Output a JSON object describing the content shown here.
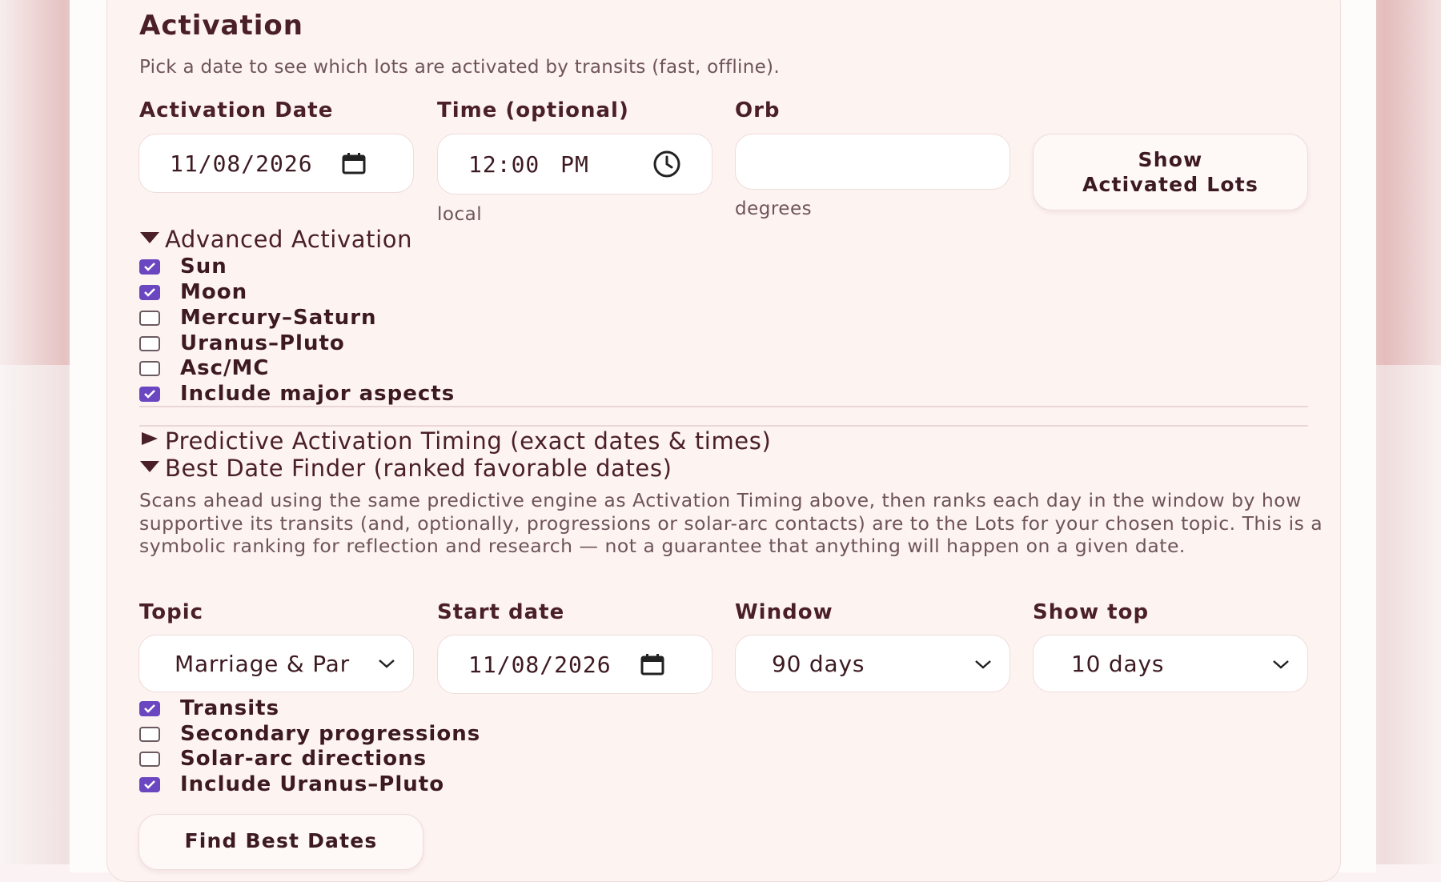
{
  "activation": {
    "title": "Activation",
    "subtitle": "Pick a date to see which lots are activated by transits (fast, offline).",
    "date_label": "Activation Date",
    "date_value": "11/08/2026",
    "time_label": "Time (optional)",
    "time_value": "12:00 PM",
    "time_hint": "local",
    "orb_label": "Orb",
    "orb_value": "",
    "orb_hint": "degrees",
    "show_button_line1": "Show",
    "show_button_line2": "Activated Lots"
  },
  "advanced": {
    "summary": "Advanced Activation",
    "expanded": true,
    "options": [
      {
        "label": "Sun",
        "checked": true
      },
      {
        "label": "Moon",
        "checked": true
      },
      {
        "label": "Mercury–Saturn",
        "checked": false
      },
      {
        "label": "Uranus–Pluto",
        "checked": false
      },
      {
        "label": "Asc/MC",
        "checked": false
      },
      {
        "label": "Include major aspects",
        "checked": true
      }
    ]
  },
  "predictive": {
    "summary": "Predictive Activation Timing (exact dates & times)",
    "expanded": false
  },
  "best_date": {
    "summary": "Best Date Finder (ranked favorable dates)",
    "expanded": true,
    "description": "Scans ahead using the same predictive engine as Activation Timing above, then ranks each day in the window by how supportive its transits (and, optionally, progressions or solar-arc contacts) are to the Lots for your chosen topic. This is a symbolic ranking for reflection and research — not a guarantee that anything will happen on a given date.",
    "topic_label": "Topic",
    "topic_value": "Marriage & Par",
    "start_label": "Start date",
    "start_value": "11/08/2026",
    "window_label": "Window",
    "window_value": "90 days",
    "showtop_label": "Show top",
    "showtop_value": "10 days",
    "options": [
      {
        "label": "Transits",
        "checked": true
      },
      {
        "label": "Secondary progressions",
        "checked": false
      },
      {
        "label": "Solar-arc directions",
        "checked": false
      },
      {
        "label": "Include Uranus–Pluto",
        "checked": true
      }
    ],
    "find_button": "Find Best Dates"
  },
  "colors": {
    "accent_checkbox": "#6b46c1",
    "text_dark": "#4a1f28",
    "card_bg": "#fdf3f1"
  },
  "icons": {
    "calendar": "calendar-icon",
    "clock": "clock-icon",
    "chevron": "chevron-down-icon",
    "triangle_down": "disclosure-open-icon",
    "triangle_right": "disclosure-closed-icon"
  }
}
